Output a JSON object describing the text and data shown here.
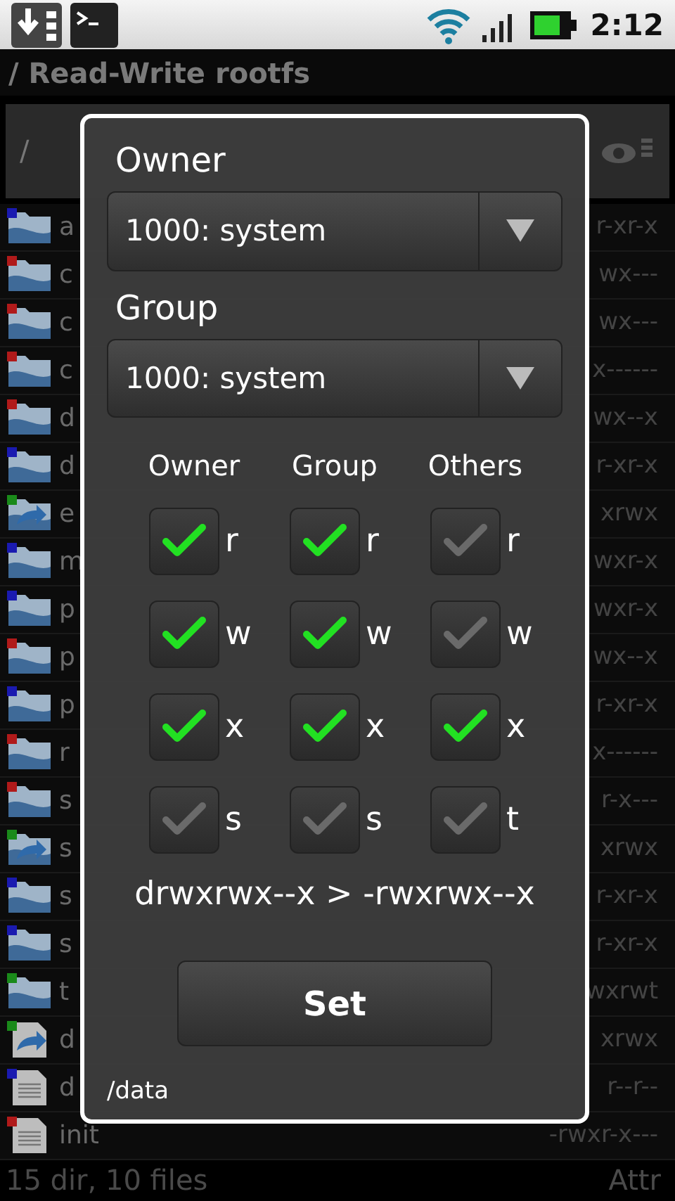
{
  "status_bar": {
    "time": "2:12"
  },
  "title": "/ Read-Write rootfs",
  "path_bar": {
    "path": "/"
  },
  "files": [
    {
      "name": "a",
      "perms": "r-xr-x",
      "kind": "folder",
      "color": "#1a1ab0"
    },
    {
      "name": "c",
      "perms": "wx---",
      "kind": "folder",
      "color": "#b01a1a"
    },
    {
      "name": "c",
      "perms": "wx---",
      "kind": "folder",
      "color": "#b01a1a"
    },
    {
      "name": "c",
      "perms": "x------",
      "kind": "folder",
      "color": "#b01a1a"
    },
    {
      "name": "d",
      "perms": "wx--x",
      "kind": "folder",
      "color": "#b01a1a"
    },
    {
      "name": "d",
      "perms": "r-xr-x",
      "kind": "folder",
      "color": "#1a1ab0"
    },
    {
      "name": "e",
      "perms": "xrwx",
      "kind": "link",
      "color": "#1a8a1a"
    },
    {
      "name": "m",
      "perms": "wxr-x",
      "kind": "folder",
      "color": "#1a1ab0"
    },
    {
      "name": "p",
      "perms": "wxr-x",
      "kind": "folder",
      "color": "#1a1ab0"
    },
    {
      "name": "p",
      "perms": "wx--x",
      "kind": "folder",
      "color": "#b01a1a"
    },
    {
      "name": "p",
      "perms": "r-xr-x",
      "kind": "folder",
      "color": "#1a1ab0"
    },
    {
      "name": "r",
      "perms": "x------",
      "kind": "folder",
      "color": "#b01a1a"
    },
    {
      "name": "s",
      "perms": "r-x---",
      "kind": "folder",
      "color": "#b01a1a"
    },
    {
      "name": "s",
      "perms": "xrwx",
      "kind": "link",
      "color": "#1a8a1a"
    },
    {
      "name": "s",
      "perms": "r-xr-x",
      "kind": "folder",
      "color": "#1a1ab0"
    },
    {
      "name": "s",
      "perms": "r-xr-x",
      "kind": "folder",
      "color": "#1a1ab0"
    },
    {
      "name": "t",
      "perms": "wxrwt",
      "kind": "folder",
      "color": "#1a8a1a"
    },
    {
      "name": "d",
      "perms": "xrwx",
      "kind": "linkfile",
      "color": "#1a8a1a"
    },
    {
      "name": "d",
      "perms": "r--r--",
      "kind": "file",
      "color": "#1a1ab0"
    },
    {
      "name": "init",
      "perms": "-rwxr-x---",
      "kind": "file",
      "color": "#b01a1a"
    }
  ],
  "footer": {
    "summary": "15 dir, 10 files",
    "mode": "Attr"
  },
  "dialog": {
    "owner_label": "Owner",
    "owner_value": "1000: system",
    "group_label": "Group",
    "group_value": "1000: system",
    "columns": [
      "Owner",
      "Group",
      "Others"
    ],
    "rows": [
      [
        {
          "letter": "r",
          "checked": true
        },
        {
          "letter": "r",
          "checked": true
        },
        {
          "letter": "r",
          "checked": false
        }
      ],
      [
        {
          "letter": "w",
          "checked": true
        },
        {
          "letter": "w",
          "checked": true
        },
        {
          "letter": "w",
          "checked": false
        }
      ],
      [
        {
          "letter": "x",
          "checked": true
        },
        {
          "letter": "x",
          "checked": true
        },
        {
          "letter": "x",
          "checked": true
        }
      ],
      [
        {
          "letter": "s",
          "checked": false
        },
        {
          "letter": "s",
          "checked": false
        },
        {
          "letter": "t",
          "checked": false
        }
      ]
    ],
    "result": "drwxrwx--x > -rwxrwx--x",
    "button": "Set",
    "path": "/data"
  }
}
